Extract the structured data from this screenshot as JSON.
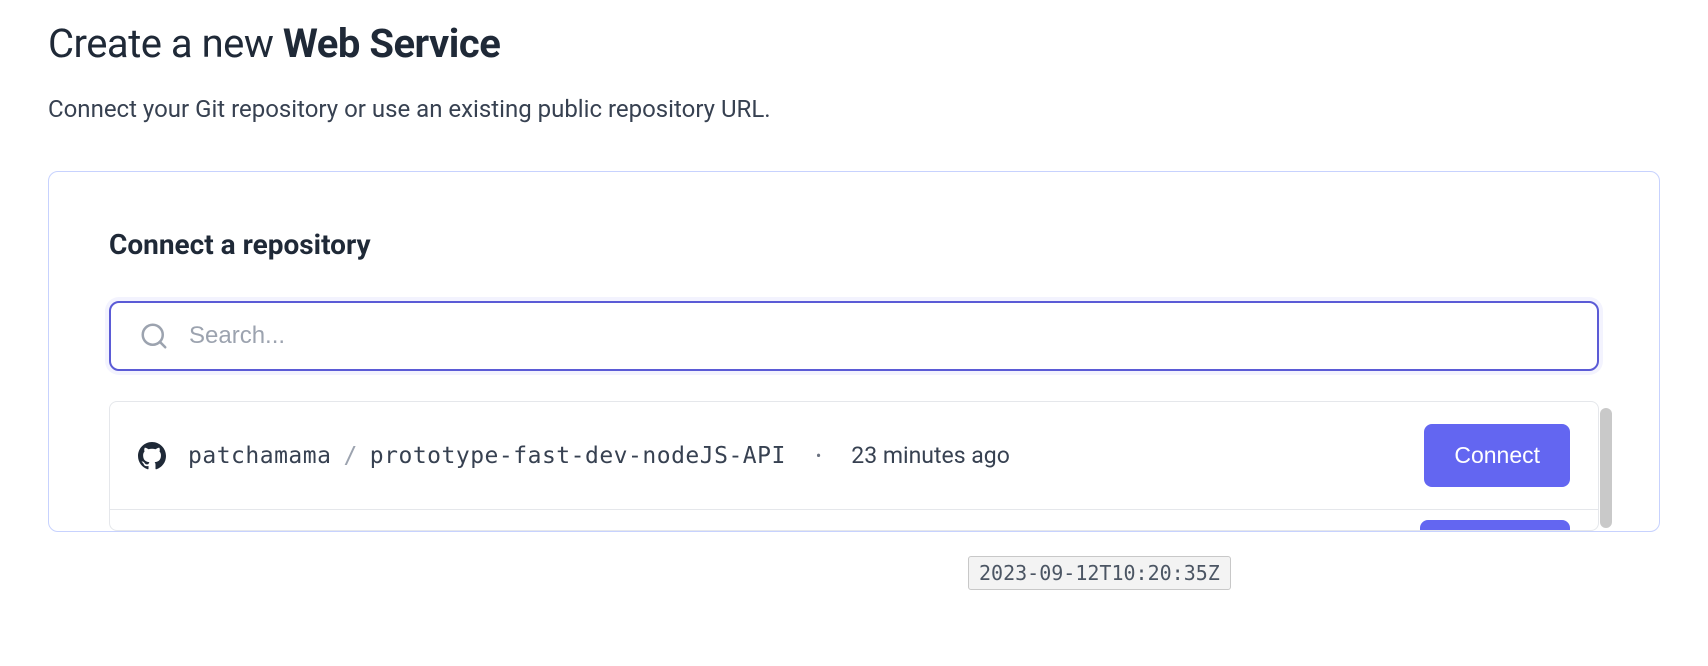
{
  "page": {
    "title_prefix": "Create a new ",
    "title_bold": "Web Service",
    "subtitle": "Connect your Git repository or use an existing public repository URL."
  },
  "card": {
    "title": "Connect a repository",
    "search_placeholder": "Search..."
  },
  "repos": [
    {
      "owner": "patchamama",
      "name": "prototype-fast-dev-nodeJS-API",
      "time_ago": "23 minutes ago",
      "connect_label": "Connect"
    }
  ],
  "tooltip": {
    "text": "2023-09-12T10:20:35Z"
  }
}
